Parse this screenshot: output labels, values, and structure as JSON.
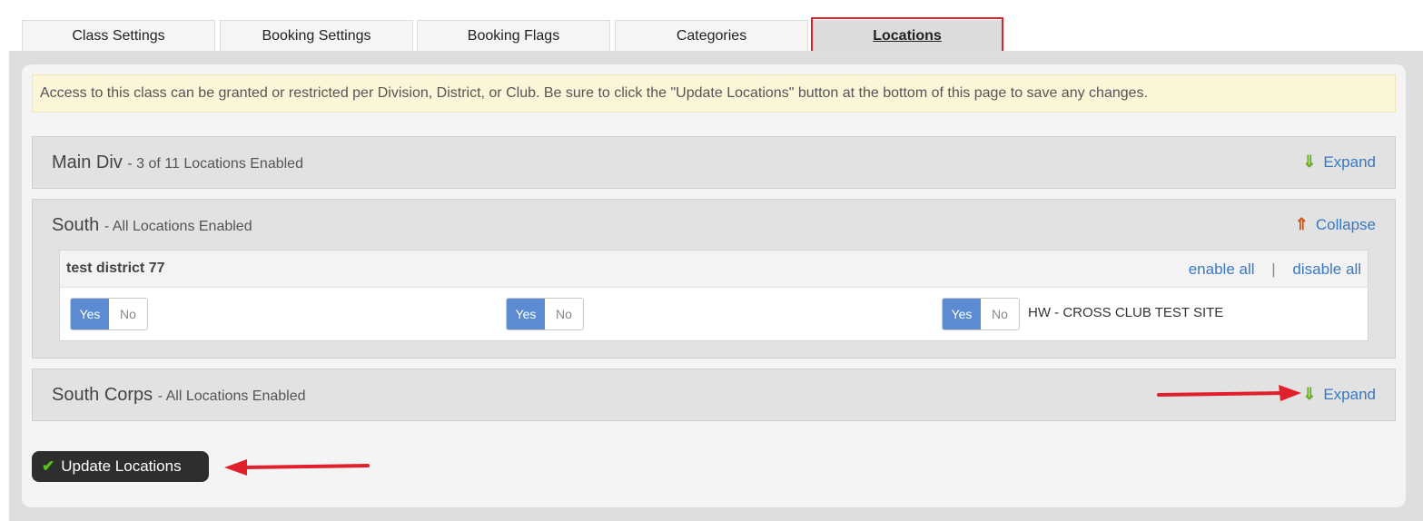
{
  "tabs": [
    {
      "label": "Class Settings"
    },
    {
      "label": "Booking Settings"
    },
    {
      "label": "Booking Flags"
    },
    {
      "label": "Categories"
    },
    {
      "label": "Locations",
      "active": true
    }
  ],
  "notice": "Access to this class can be granted or restricted per Division, District, or Club. Be sure to click the \"Update Locations\" button at the bottom of this page to save any changes.",
  "sections": [
    {
      "name": "Main Div",
      "status": "- 3 of 11 Locations Enabled",
      "action": "Expand",
      "action_icon": "arrow-down-icon"
    },
    {
      "name": "South",
      "status": "- All Locations Enabled",
      "action": "Collapse",
      "action_icon": "arrow-up-icon"
    },
    {
      "name": "South Corps",
      "status": "- All Locations Enabled",
      "action": "Expand",
      "action_icon": "arrow-down-icon"
    }
  ],
  "district": {
    "name": "test district 77",
    "enable_all": "enable all",
    "separator": "|",
    "disable_all": "disable all",
    "locations": [
      {
        "yes": "Yes",
        "no": "No",
        "label": "",
        "value": "Yes"
      },
      {
        "yes": "Yes",
        "no": "No",
        "label": "",
        "value": "Yes"
      },
      {
        "yes": "Yes",
        "no": "No",
        "label": "HW - CROSS CLUB TEST SITE",
        "value": "Yes"
      }
    ]
  },
  "update_button": {
    "label": "Update Locations",
    "icon": "check-icon"
  },
  "colors": {
    "toggle_active": "#5b8bd0",
    "link": "#3a78c2",
    "annotation": "#e0202a",
    "notice_bg": "#fcf6d9"
  }
}
